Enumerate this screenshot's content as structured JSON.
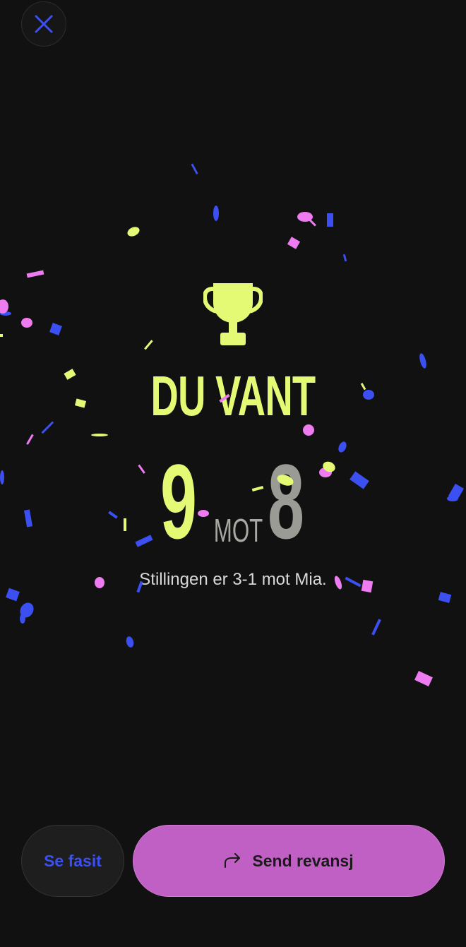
{
  "close": {
    "icon": "close-icon"
  },
  "result": {
    "trophy_icon": "trophy-icon",
    "headline": "DU VANT",
    "score_you": "9",
    "score_separator": "MOT",
    "score_opponent": "8",
    "status": "Stillingen er 3-1 mot Mia."
  },
  "actions": {
    "see_answers_label": "Se fasit",
    "send_rematch_label": "Send revansj",
    "send_rematch_icon": "share-arrow-icon"
  },
  "colors": {
    "background": "#111111",
    "accent_yellow": "#e4fa74",
    "accent_blue": "#3c4ff0",
    "accent_pink": "#ee7bf0",
    "button_purple": "#c160c4",
    "score_grey": "#9b9b96"
  }
}
